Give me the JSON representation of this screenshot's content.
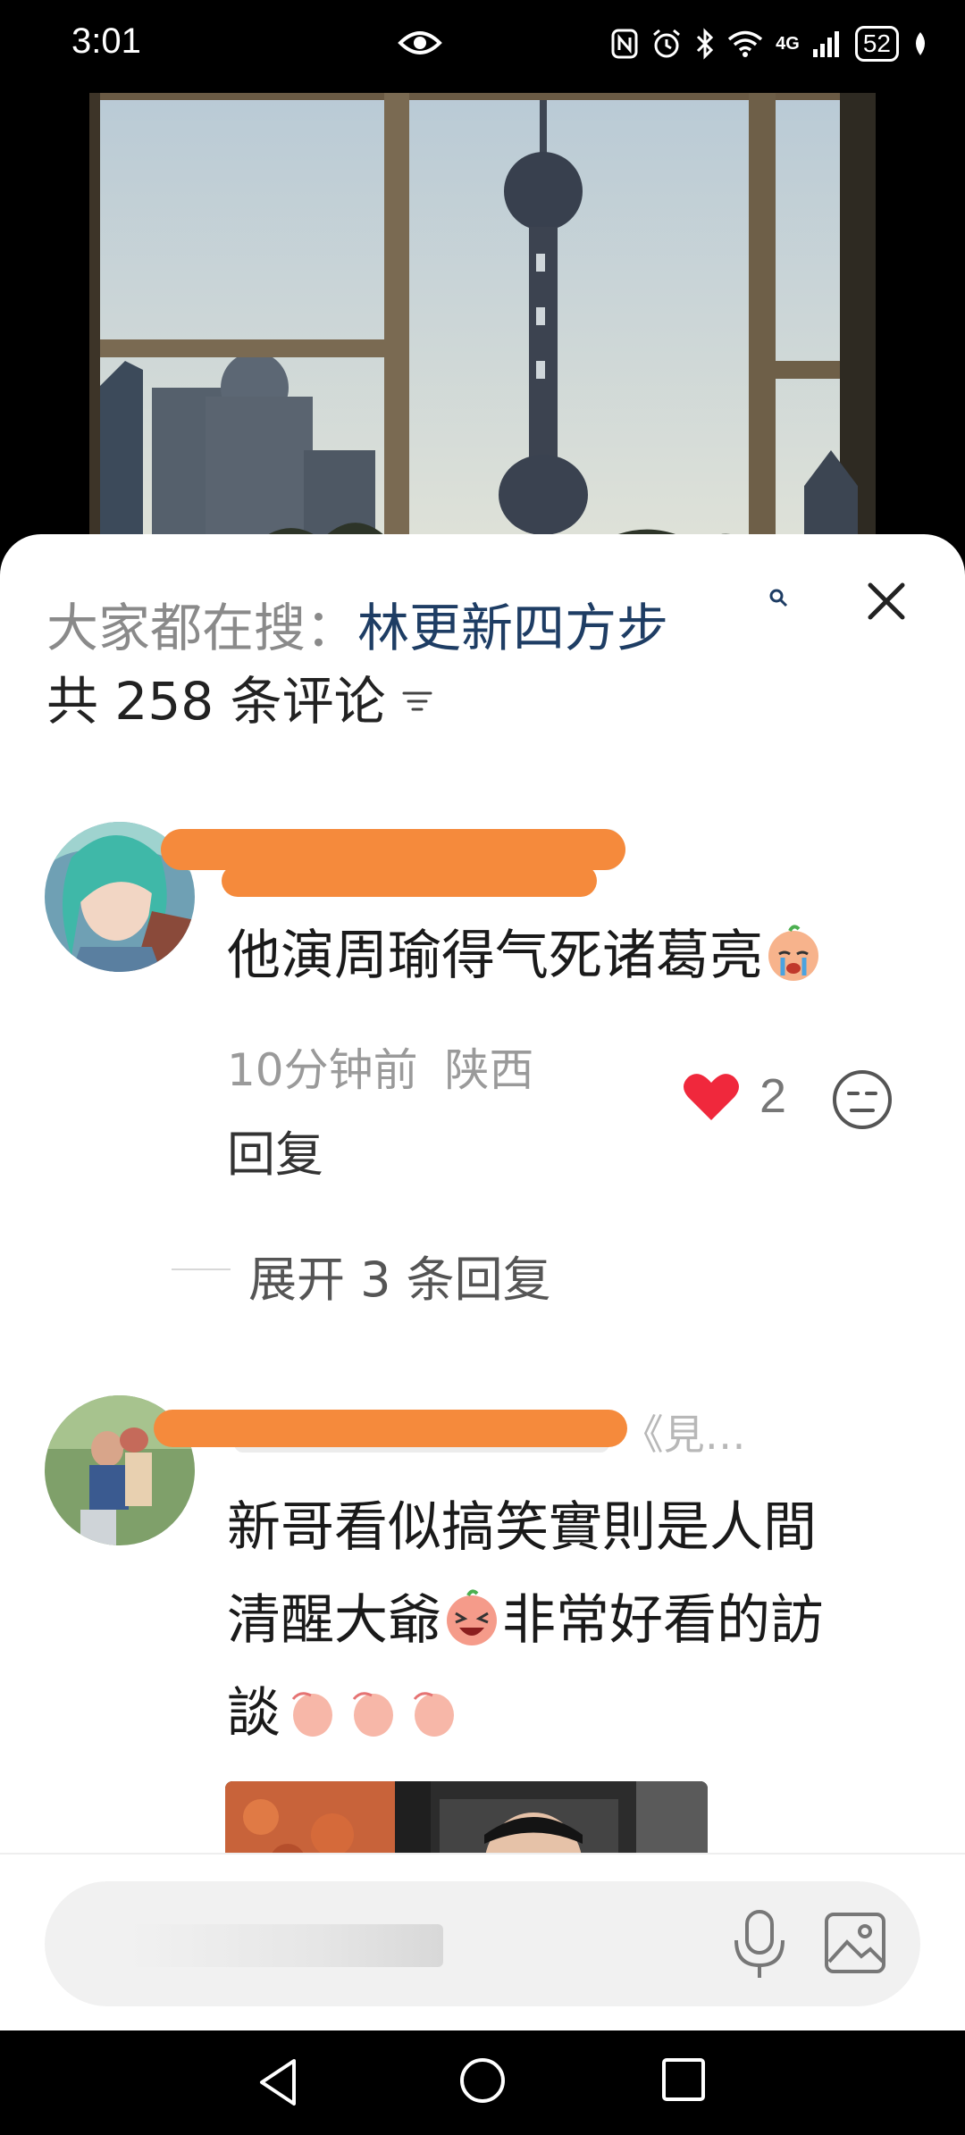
{
  "status_bar": {
    "time": "3:01",
    "network": "4G",
    "battery": "52",
    "icons": [
      "eye-icon",
      "nfc-icon",
      "alarm-icon",
      "bluetooth-icon",
      "wifi-icon",
      "signal-icon",
      "battery-icon",
      "leaf-icon"
    ]
  },
  "video": {
    "description_icon": "video-frame"
  },
  "sheet": {
    "search_prefix": "大家都在搜：",
    "search_term": "林更新四方步",
    "comment_count_text": "共 258 条评论",
    "comments": [
      {
        "text": "他演周瑜得气死诸葛亮",
        "time": "10分钟前",
        "location": "陕西",
        "likes": "2",
        "reply_label": "回复",
        "expand_label": "展开 3 条回复"
      },
      {
        "username_tail": "《見…",
        "text_line1": "新哥看似搞笑實則是人間",
        "text_line2a": "清醒大爺",
        "text_line2b": "非常好看的訪",
        "text_line3": "談"
      }
    ]
  },
  "colors": {
    "accent_blue": "#1e3d64",
    "like_red": "#f0283c",
    "redaction_orange": "#f58a3c"
  }
}
